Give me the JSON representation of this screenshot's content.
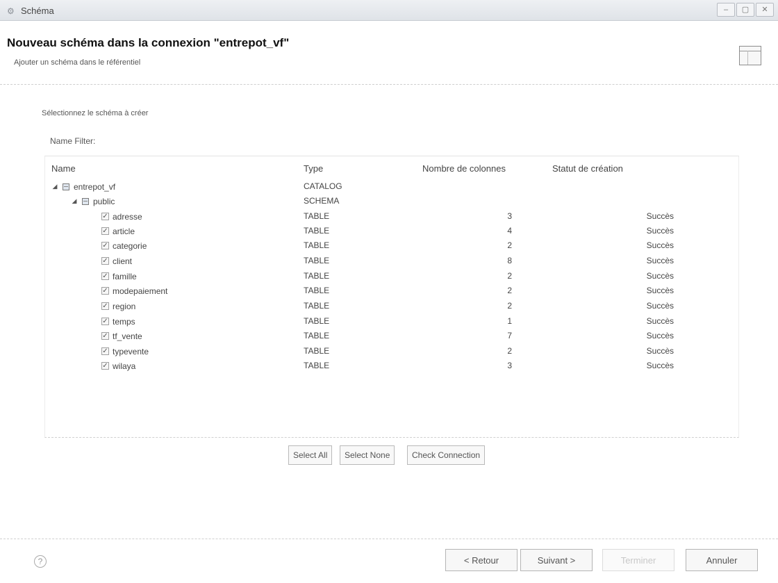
{
  "window": {
    "title": "Schéma",
    "min_label": "–",
    "max_label": "▢",
    "close_label": "✕"
  },
  "header": {
    "title": "Nouveau schéma dans la connexion \"entrepot_vf\"",
    "subtitle": "Ajouter un schéma dans le référentiel"
  },
  "body": {
    "select_label": "Sélectionnez le schéma à créer",
    "filter_label": "Name Filter:",
    "filter_value": ""
  },
  "table": {
    "columns": [
      "Name",
      "Type",
      "Nombre de colonnes",
      "Statut de création"
    ],
    "catalog": {
      "name": "entrepot_vf",
      "type": "CATALOG"
    },
    "schema": {
      "name": "public",
      "type": "SCHEMA"
    },
    "rows": [
      {
        "name": "adresse",
        "type": "TABLE",
        "count": "3",
        "status": "Succès",
        "checked": true
      },
      {
        "name": "article",
        "type": "TABLE",
        "count": "4",
        "status": "Succès",
        "checked": true
      },
      {
        "name": "categorie",
        "type": "TABLE",
        "count": "2",
        "status": "Succès",
        "checked": true
      },
      {
        "name": "client",
        "type": "TABLE",
        "count": "8",
        "status": "Succès",
        "checked": true
      },
      {
        "name": "famille",
        "type": "TABLE",
        "count": "2",
        "status": "Succès",
        "checked": true
      },
      {
        "name": "modepaiement",
        "type": "TABLE",
        "count": "2",
        "status": "Succès",
        "checked": true
      },
      {
        "name": "region",
        "type": "TABLE",
        "count": "2",
        "status": "Succès",
        "checked": true
      },
      {
        "name": "temps",
        "type": "TABLE",
        "count": "1",
        "status": "Succès",
        "checked": true
      },
      {
        "name": "tf_vente",
        "type": "TABLE",
        "count": "7",
        "status": "Succès",
        "checked": true
      },
      {
        "name": "typevente",
        "type": "TABLE",
        "count": "2",
        "status": "Succès",
        "checked": true
      },
      {
        "name": "wilaya",
        "type": "TABLE",
        "count": "3",
        "status": "Succès",
        "checked": true
      }
    ]
  },
  "actions": {
    "select_all": "Select All",
    "select_none": "Select None",
    "check_connection": "Check Connection"
  },
  "footer": {
    "help": "?",
    "back": "< Retour",
    "next": "Suivant >",
    "finish": "Terminer",
    "cancel": "Annuler"
  }
}
